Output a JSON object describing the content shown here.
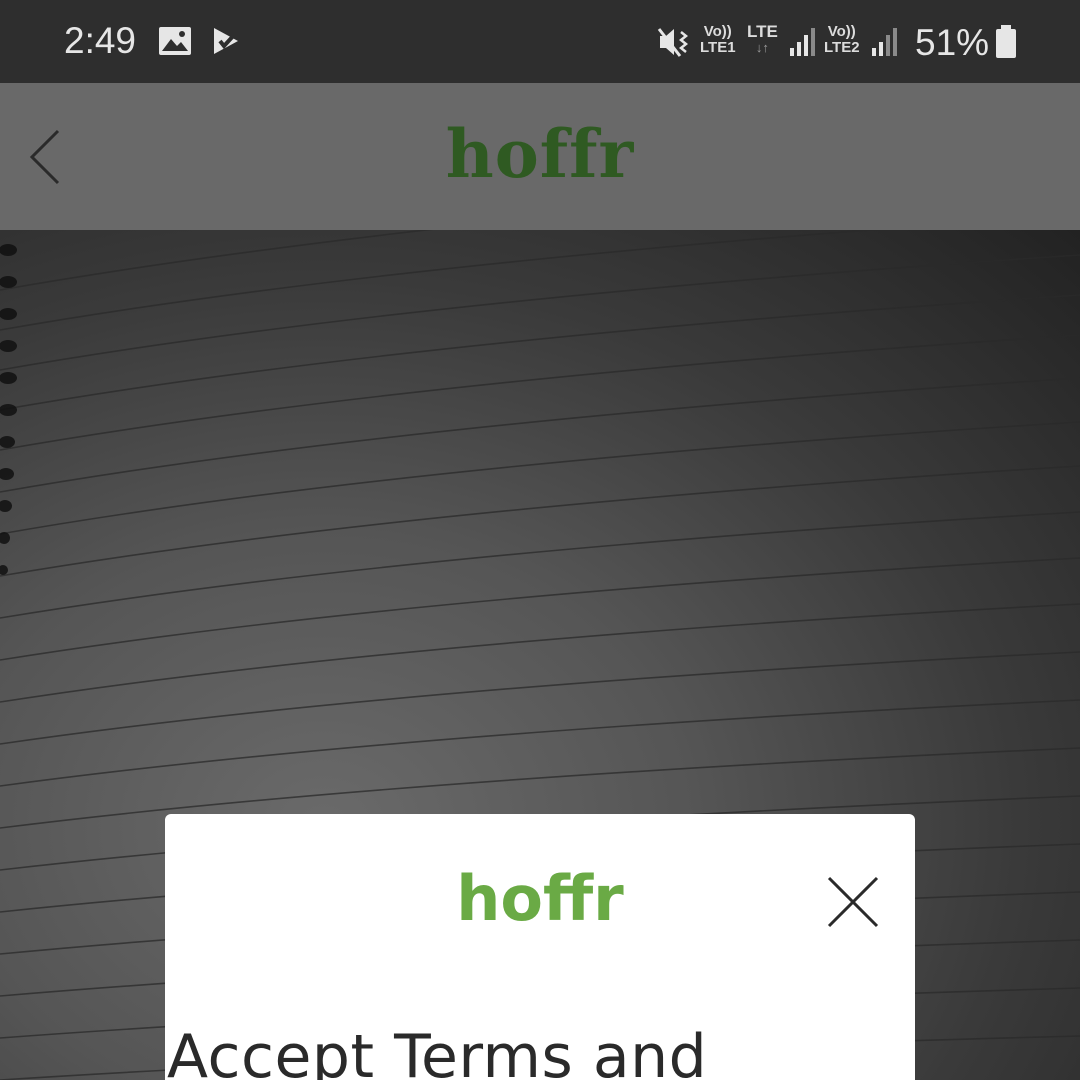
{
  "status_bar": {
    "time": "2:49",
    "network": {
      "volte1_top": "Vo))",
      "volte1_bottom": "LTE1",
      "lte_label": "LTE",
      "volte2_top": "Vo))",
      "volte2_bottom": "LTE2"
    },
    "battery_percent": "51%",
    "icons": [
      "image-icon",
      "task-check-icon",
      "mute-vibrate-icon",
      "signal-icon",
      "battery-icon"
    ]
  },
  "app_bar": {
    "logo_text": "hoffr",
    "logo_color": "#2f5a22",
    "background": "#696969"
  },
  "dialog": {
    "logo_text": "hoffr",
    "logo_color": "#6aaa45",
    "heading": "Accept Terms and"
  }
}
